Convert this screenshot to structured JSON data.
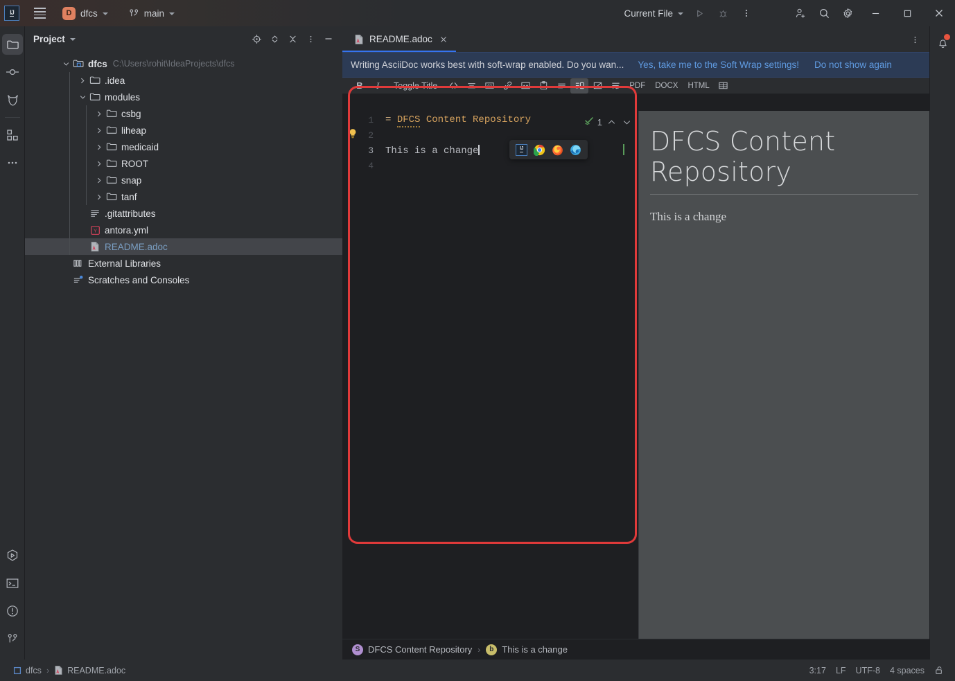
{
  "titlebar": {
    "logo": "intellij-logo",
    "menu_icon": "hamburger-icon",
    "project_badge": "D",
    "project_name": "dfcs",
    "branch_icon": "branch-icon",
    "branch_name": "main",
    "run_config": "Current File",
    "run_icon": "run-icon",
    "debug_icon": "debug-icon",
    "more_icon": "more-vertical-icon",
    "code_with_me_icon": "add-user-icon",
    "search_icon": "search-icon",
    "settings_icon": "gear-icon",
    "minimize": "minimize-icon",
    "maximize": "maximize-icon",
    "close": "close-icon"
  },
  "rail": {
    "items": [
      {
        "name": "project",
        "icon": "folder-icon",
        "selected": true
      },
      {
        "name": "commit",
        "icon": "commit-icon",
        "selected": false
      },
      {
        "name": "pull-requests",
        "icon": "pull-request-icon",
        "selected": false
      },
      {
        "name": "structure",
        "icon": "structure-icon",
        "selected": false
      },
      {
        "name": "more-tool-windows",
        "icon": "more-horizontal-icon",
        "selected": false
      }
    ],
    "bottom_items": [
      {
        "name": "run",
        "icon": "run-hex-icon"
      },
      {
        "name": "terminal",
        "icon": "terminal-icon"
      },
      {
        "name": "problems",
        "icon": "warning-circle-icon"
      },
      {
        "name": "git",
        "icon": "git-branch-icon"
      }
    ]
  },
  "project_panel": {
    "title": "Project",
    "title_chevron": "chevron-down-icon",
    "header_icons": [
      {
        "name": "select-opened-file",
        "icon": "target-icon"
      },
      {
        "name": "expand-collapse",
        "icon": "up-down-chevron-icon"
      },
      {
        "name": "collapse-all",
        "icon": "collapse-all-icon"
      },
      {
        "name": "panel-options",
        "icon": "more-vertical-icon"
      },
      {
        "name": "hide-panel",
        "icon": "minus-icon"
      }
    ],
    "tree": [
      {
        "label": "dfcs",
        "path": "C:\\Users\\rohit\\IdeaProjects\\dfcs",
        "depth": 0,
        "expanded": true,
        "icon": "project-root-icon",
        "bold": true,
        "selected": false
      },
      {
        "label": ".idea",
        "path": "",
        "depth": 1,
        "expanded": false,
        "icon": "folder-icon",
        "bold": false,
        "selected": false
      },
      {
        "label": "modules",
        "path": "",
        "depth": 1,
        "expanded": true,
        "icon": "folder-icon",
        "bold": false,
        "selected": false
      },
      {
        "label": "csbg",
        "path": "",
        "depth": 2,
        "expanded": false,
        "icon": "folder-icon",
        "bold": false,
        "selected": false
      },
      {
        "label": "liheap",
        "path": "",
        "depth": 2,
        "expanded": false,
        "icon": "folder-icon",
        "bold": false,
        "selected": false
      },
      {
        "label": "medicaid",
        "path": "",
        "depth": 2,
        "expanded": false,
        "icon": "folder-icon",
        "bold": false,
        "selected": false
      },
      {
        "label": "ROOT",
        "path": "",
        "depth": 2,
        "expanded": false,
        "icon": "folder-icon",
        "bold": false,
        "selected": false
      },
      {
        "label": "snap",
        "path": "",
        "depth": 2,
        "expanded": false,
        "icon": "folder-icon",
        "bold": false,
        "selected": false
      },
      {
        "label": "tanf",
        "path": "",
        "depth": 2,
        "expanded": false,
        "icon": "folder-icon",
        "bold": false,
        "selected": false
      },
      {
        "label": ".gitattributes",
        "path": "",
        "depth": 1,
        "expanded": null,
        "icon": "text-file-icon",
        "bold": false,
        "selected": false
      },
      {
        "label": "antora.yml",
        "path": "",
        "depth": 1,
        "expanded": null,
        "icon": "yaml-file-icon",
        "bold": false,
        "selected": false
      },
      {
        "label": "README.adoc",
        "path": "",
        "depth": 1,
        "expanded": null,
        "icon": "asciidoc-file-icon",
        "bold": false,
        "selected": true
      },
      {
        "label": "External Libraries",
        "path": "",
        "depth": 0,
        "expanded": null,
        "icon": "libraries-icon",
        "bold": false,
        "selected": false
      },
      {
        "label": "Scratches and Consoles",
        "path": "",
        "depth": 0,
        "expanded": null,
        "icon": "scratches-icon",
        "bold": false,
        "selected": false
      }
    ]
  },
  "editor": {
    "tab": {
      "label": "README.adoc",
      "icon": "asciidoc-file-icon",
      "close_icon": "close-icon"
    },
    "tab_options_icon": "more-vertical-icon",
    "notification": {
      "message": "Writing AsciiDoc works best with soft-wrap enabled. Do you wan...",
      "action": "Yes, take me to the Soft Wrap settings!",
      "dismiss": "Do not show again"
    },
    "toolbar": {
      "bold": "B",
      "italic": "I",
      "toggle_title": "Toggle Title",
      "icons": [
        {
          "name": "code-inline-icon",
          "glyph": "<>"
        },
        {
          "name": "horizontal-rule-icon",
          "glyph": "rule"
        },
        {
          "name": "admonition-icon",
          "glyph": "adm"
        },
        {
          "name": "link-icon",
          "glyph": "link"
        },
        {
          "name": "image-icon",
          "glyph": "image"
        },
        {
          "name": "paste-image-icon",
          "glyph": "clipboard"
        },
        {
          "name": "list-icon",
          "glyph": "list"
        },
        {
          "name": "split-editor-icon",
          "glyph": "split",
          "active": true
        },
        {
          "name": "hide-preview-icon",
          "glyph": "hidepreview"
        },
        {
          "name": "soft-wrap-icon",
          "glyph": "wrap"
        }
      ],
      "exports": [
        "PDF",
        "DOCX",
        "HTML"
      ],
      "table_icon": "table-icon"
    },
    "lines": [
      {
        "number": "1",
        "prefix": "= ",
        "token": "DFCS",
        "rest": " Content Repository",
        "type": "heading"
      },
      {
        "number": "2",
        "prefix": "",
        "token": "",
        "rest": "",
        "type": "blank"
      },
      {
        "number": "3",
        "prefix": "",
        "token": "",
        "rest": "This is a change",
        "type": "text"
      },
      {
        "number": "4",
        "prefix": "",
        "token": "",
        "rest": "",
        "type": "blank"
      }
    ],
    "inspection": {
      "icon": "inspection-check-icon",
      "count": "1",
      "up_icon": "chevron-up-icon",
      "down_icon": "chevron-down-icon"
    },
    "intention_bulb": "lightbulb-icon",
    "browser_popup": [
      {
        "name": "open-in-intellij-browser",
        "icon": "intellij-icon"
      },
      {
        "name": "open-in-chrome",
        "icon": "chrome-icon"
      },
      {
        "name": "open-in-firefox",
        "icon": "firefox-icon"
      },
      {
        "name": "open-in-edge",
        "icon": "edge-icon"
      }
    ],
    "preview": {
      "title": "DFCS Content Repository",
      "body": "This is a change"
    },
    "breadcrumb": [
      {
        "badge": "S",
        "badge_color": "#b08fd0",
        "label": "DFCS Content Repository"
      },
      {
        "badge": "b",
        "badge_color": "#c8bd6a",
        "label": "This is a change"
      }
    ],
    "breadcrumb_separator": "›"
  },
  "right_rail": {
    "notifications_icon": "bell-icon",
    "has_badge": true
  },
  "status_bar": {
    "breadcrumb": [
      {
        "icon": "module-icon",
        "label": "dfcs"
      },
      {
        "icon": "asciidoc-file-icon",
        "label": "README.adoc"
      }
    ],
    "separator": "›",
    "caret_position": "3:17",
    "line_separator": "LF",
    "encoding": "UTF-8",
    "indent": "4 spaces",
    "lock_icon": "unlocked-icon"
  },
  "annotation": {
    "name": "red-highlight-rectangle",
    "color": "#e03a3a"
  }
}
